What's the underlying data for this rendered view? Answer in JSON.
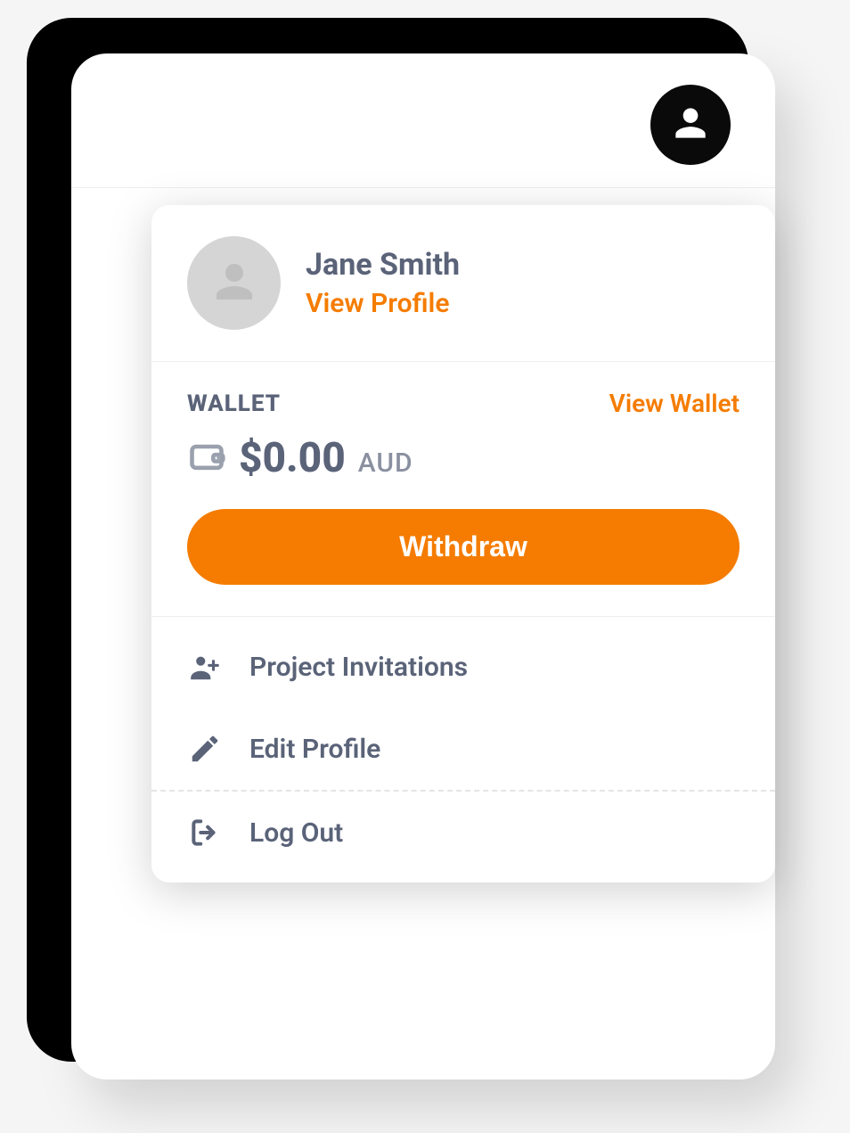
{
  "profile": {
    "name": "Jane Smith",
    "view_profile_label": "View Profile"
  },
  "wallet": {
    "section_label": "WALLET",
    "view_link_label": "View Wallet",
    "balance_amount": "$0.00",
    "balance_currency": "AUD",
    "withdraw_label": "Withdraw"
  },
  "menu": {
    "items": [
      {
        "label": "Project Invitations",
        "icon": "person-add-icon"
      },
      {
        "label": "Edit Profile",
        "icon": "pencil-icon"
      },
      {
        "label": "Log Out",
        "icon": "logout-icon"
      }
    ]
  },
  "colors": {
    "accent": "#f57c00",
    "text_primary": "#5a6378",
    "text_muted": "#8a90a0"
  }
}
